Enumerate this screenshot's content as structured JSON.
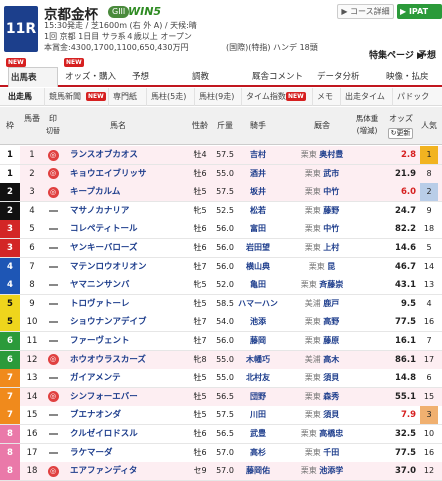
{
  "race": {
    "number": "11R",
    "name": "京都金杯",
    "grade": "GIII",
    "win5": "WIN5",
    "info1": "15:30発走 / 芝1600m (右 外 A) / 天候:晴",
    "info2": "1回 京都 1日目 サラ系４歳以上 オープン",
    "info3": "本賞金:4300,1700,1100,650,430万円",
    "info4": "(国際)(特指) ハンデ 18頭",
    "fav_label": "特集ページ ▶",
    "preview_label": "予想"
  },
  "buttons": {
    "course": "▶ コース詳細",
    "ipat": "▶ IPAT"
  },
  "tabs": [
    {
      "label": "出馬表"
    },
    {
      "label": "オッズ・購入"
    },
    {
      "label": "予想"
    },
    {
      "label": "調教"
    },
    {
      "label": "厩舎コメント"
    },
    {
      "label": "データ分析"
    },
    {
      "label": "映像・払戻"
    }
  ],
  "subtabs": [
    "出走馬",
    "競馬新聞",
    "専門紙",
    "馬柱(5走)",
    "馬柱(9走)",
    "タイム指数",
    "メモ",
    "出走タイム",
    "パドック"
  ],
  "new_badge": "NEW",
  "table_header": {
    "waku": "枠",
    "umaban": "馬番",
    "mark": "印",
    "mark_sub": "切替",
    "horse": "馬名",
    "sexage": "性齢",
    "weight": "斤量",
    "jockey": "騎手",
    "trainer": "厩舎",
    "bodyweight": "馬体重",
    "bodyweight_sub": "(増減)",
    "odds": "オッズ",
    "refresh": "更新",
    "pop": "人気"
  },
  "horses": [
    {
      "waku": "1",
      "uma": "1",
      "mark": "circle",
      "name": "ランスオブカオス",
      "sexage": "牡4",
      "weight": "57.5",
      "jockey": "吉村",
      "trainer_region": "栗東",
      "trainer": "奥村豊",
      "odds": "2.8",
      "pop": "1"
    },
    {
      "waku": "1",
      "uma": "2",
      "mark": "circle",
      "name": "キョウエイブリッサ",
      "sexage": "牡6",
      "weight": "55.0",
      "jockey": "酒井",
      "trainer_region": "栗東",
      "trainer": "武市",
      "odds": "21.9",
      "pop": "8"
    },
    {
      "waku": "2",
      "uma": "3",
      "mark": "circle",
      "name": "キープカルム",
      "sexage": "牡5",
      "weight": "57.5",
      "jockey": "坂井",
      "trainer_region": "栗東",
      "trainer": "中竹",
      "odds": "6.0",
      "pop": "2"
    },
    {
      "waku": "2",
      "uma": "4",
      "mark": "dash",
      "name": "マサノカナリア",
      "sexage": "牝5",
      "weight": "52.5",
      "jockey": "松若",
      "trainer_region": "栗東",
      "trainer": "藤野",
      "odds": "24.7",
      "pop": "9"
    },
    {
      "waku": "3",
      "uma": "5",
      "mark": "dash",
      "name": "コレペティトール",
      "sexage": "牡6",
      "weight": "56.0",
      "jockey": "富田",
      "trainer_region": "栗東",
      "trainer": "中竹",
      "odds": "82.2",
      "pop": "18"
    },
    {
      "waku": "3",
      "uma": "6",
      "mark": "dash",
      "name": "ヤンキーバローズ",
      "sexage": "牡6",
      "weight": "56.0",
      "jockey": "岩田望",
      "trainer_region": "栗東",
      "trainer": "上村",
      "odds": "14.6",
      "pop": "5"
    },
    {
      "waku": "4",
      "uma": "7",
      "mark": "dash",
      "name": "マテンロウオリオン",
      "sexage": "牡7",
      "weight": "56.0",
      "jockey": "横山典",
      "trainer_region": "栗東",
      "trainer": "昆",
      "odds": "46.7",
      "pop": "14"
    },
    {
      "waku": "4",
      "uma": "8",
      "mark": "dash",
      "name": "ヤマニンサンバ",
      "sexage": "牝5",
      "weight": "52.0",
      "jockey": "亀田",
      "trainer_region": "栗東",
      "trainer": "斉藤崇",
      "odds": "43.1",
      "pop": "13"
    },
    {
      "waku": "5",
      "uma": "9",
      "mark": "dash",
      "name": "トロヴァトーレ",
      "sexage": "牡5",
      "weight": "58.5",
      "jockey": "ハマーハン",
      "trainer_region": "美浦",
      "trainer": "鹿戸",
      "odds": "9.5",
      "pop": "4"
    },
    {
      "waku": "5",
      "uma": "10",
      "mark": "dash",
      "name": "ショウナンアデイブ",
      "sexage": "牡7",
      "weight": "54.0",
      "jockey": "池添",
      "trainer_region": "栗東",
      "trainer": "高野",
      "odds": "77.5",
      "pop": "16"
    },
    {
      "waku": "6",
      "uma": "11",
      "mark": "dash",
      "name": "ファーヴェント",
      "sexage": "牡7",
      "weight": "56.0",
      "jockey": "藤岡",
      "trainer_region": "栗東",
      "trainer": "藤原",
      "odds": "16.1",
      "pop": "7"
    },
    {
      "waku": "6",
      "uma": "12",
      "mark": "circle",
      "name": "ホウオウラスカーズ",
      "sexage": "牝8",
      "weight": "55.0",
      "jockey": "木幡巧",
      "trainer_region": "美浦",
      "trainer": "高木",
      "odds": "86.1",
      "pop": "17"
    },
    {
      "waku": "7",
      "uma": "13",
      "mark": "dash",
      "name": "ガイアメンテ",
      "sexage": "牡5",
      "weight": "55.0",
      "jockey": "北村友",
      "trainer_region": "栗東",
      "trainer": "須貝",
      "odds": "14.8",
      "pop": "6"
    },
    {
      "waku": "7",
      "uma": "14",
      "mark": "circle",
      "name": "シンフォーエバー",
      "sexage": "牡5",
      "weight": "56.5",
      "jockey": "団野",
      "trainer_region": "栗東",
      "trainer": "森秀",
      "odds": "55.1",
      "pop": "15"
    },
    {
      "waku": "7",
      "uma": "15",
      "mark": "dash",
      "name": "ブエナオンダ",
      "sexage": "牡5",
      "weight": "57.5",
      "jockey": "川田",
      "trainer_region": "栗東",
      "trainer": "須貝",
      "odds": "7.9",
      "pop": "3"
    },
    {
      "waku": "8",
      "uma": "16",
      "mark": "dash",
      "name": "クルゼイロドスル",
      "sexage": "牡6",
      "weight": "56.5",
      "jockey": "武豊",
      "trainer_region": "栗東",
      "trainer": "高橋忠",
      "odds": "32.5",
      "pop": "10"
    },
    {
      "waku": "8",
      "uma": "17",
      "mark": "dash",
      "name": "ラケマーダ",
      "sexage": "牡6",
      "weight": "57.0",
      "jockey": "高杉",
      "trainer_region": "栗東",
      "trainer": "千田",
      "odds": "77.5",
      "pop": "16"
    },
    {
      "waku": "8",
      "uma": "18",
      "mark": "circle",
      "name": "エアファンディタ",
      "sexage": "セ9",
      "weight": "57.0",
      "jockey": "藤岡佑",
      "trainer_region": "栗東",
      "trainer": "池添学",
      "odds": "37.0",
      "pop": "12"
    }
  ],
  "colors": {
    "waku": [
      "#ffffff",
      "#111111",
      "#d32626",
      "#1e56b5",
      "#efd51c",
      "#2b9a3a",
      "#f08a1c",
      "#ea79a9"
    ],
    "accent": "#c1161e",
    "header_blue": "#1c3f8c",
    "odds_red": "#d62020",
    "fav_row": "#fdeef2"
  }
}
